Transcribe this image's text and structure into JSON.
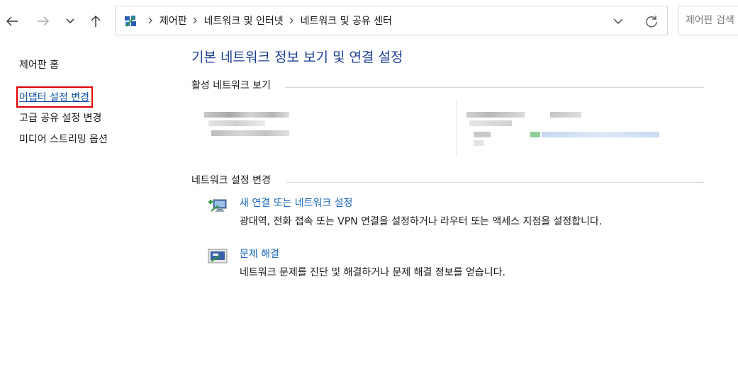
{
  "window": {
    "breadcrumbs": [
      "제어판",
      "네트워크 및 인터넷",
      "네트워크 및 공유 센터"
    ],
    "search_placeholder": "제어판 검색"
  },
  "sidebar": {
    "items": [
      {
        "label": "제어판 홈"
      },
      {
        "label": "어댑터 설정 변경",
        "highlighted": true
      },
      {
        "label": "고급 공유 설정 변경"
      },
      {
        "label": "미디어 스트리밍 옵션"
      }
    ],
    "highlight_color": "#e00000"
  },
  "main": {
    "title": "기본 네트워크 정보 보기 및 연결 설정",
    "active_networks_header": "활성 네트워크 보기",
    "change_settings_header": "네트워크 설정 변경",
    "tasks": [
      {
        "icon": "new-connection-icon",
        "link": "새 연결 또는 네트워크 설정",
        "description": "광대역, 전화 접속 또는 VPN 연결을 설정하거나 라우터 또는 액세스 지점을 설정합니다."
      },
      {
        "icon": "troubleshoot-icon",
        "link": "문제 해결",
        "description": "네트워크 문제를 진단 및 해결하거나 문제 해결 정보를 얻습니다."
      }
    ]
  },
  "colors": {
    "title": "#1c3f94",
    "link": "#1565b8"
  }
}
